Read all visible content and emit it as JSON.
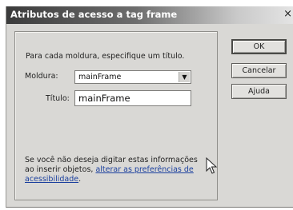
{
  "dialog": {
    "title": "Atributos de acesso a tag frame",
    "close_symbol": "×"
  },
  "form": {
    "instruction": "Para cada moldura, especifique um título.",
    "moldura_label": "Moldura:",
    "moldura_value": "mainFrame",
    "titulo_label": "Título:",
    "titulo_value": "mainFrame"
  },
  "note": {
    "text": "Se você não deseja digitar estas informações ao inserir objetos,",
    "link": "alterar as preferências de acessibilidade",
    "suffix": "."
  },
  "buttons": {
    "ok": "OK",
    "cancelar": "Cancelar",
    "ajuda": "Ajuda"
  },
  "icons": {
    "select_arrow": "chevron-down-icon",
    "pointer": "mouse-pointer-icon"
  }
}
